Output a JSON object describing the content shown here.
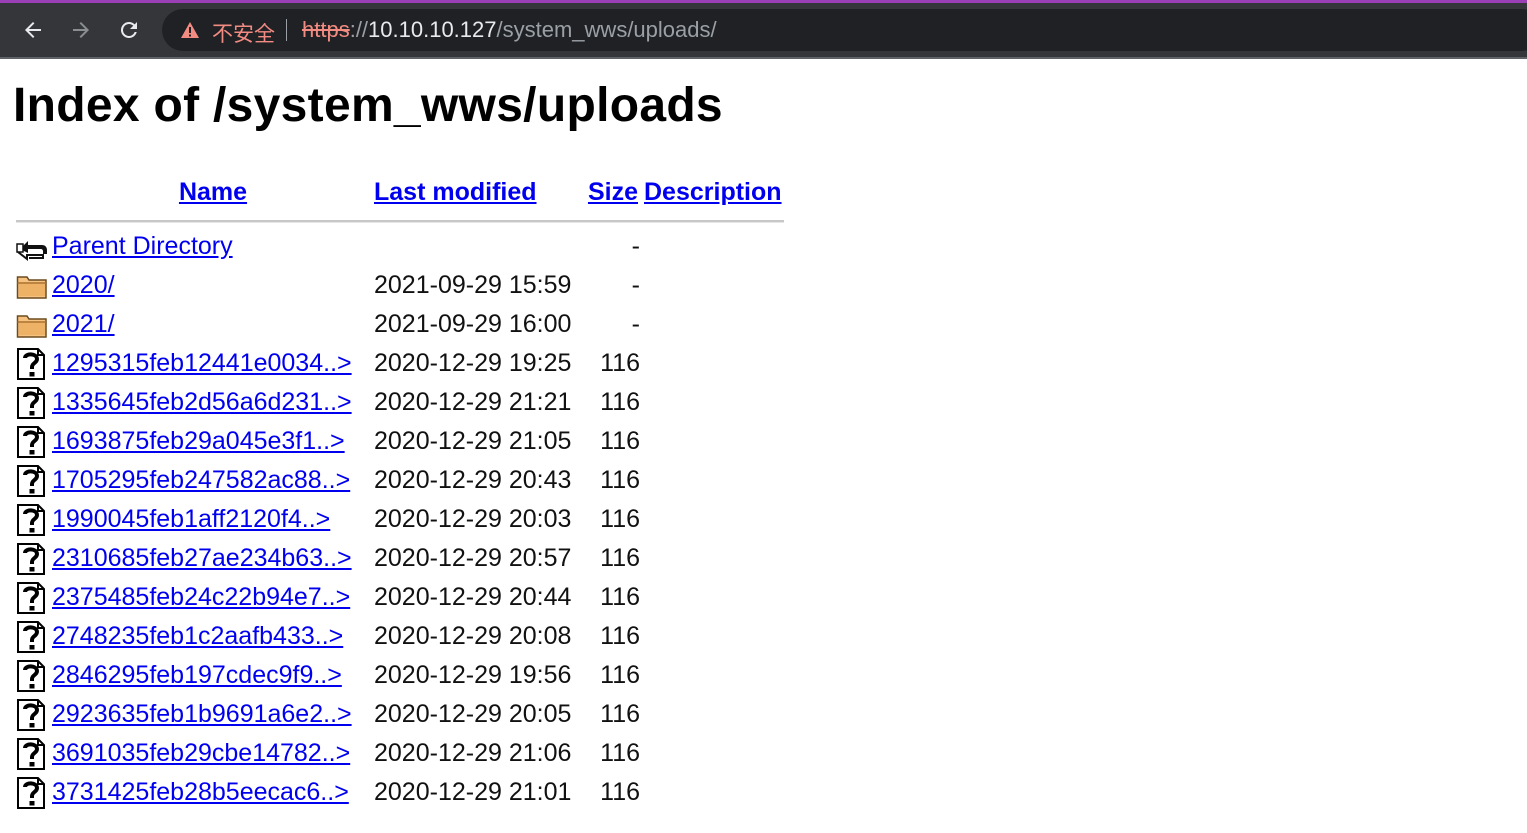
{
  "browser": {
    "insecure_label": "不安全",
    "url_scheme": "https",
    "url_sep": "://",
    "url_host": "10.10.10.127",
    "url_path": "/system_wws/uploads/"
  },
  "page": {
    "title": "Index of /system_wws/uploads"
  },
  "table": {
    "headers": {
      "name": "Name",
      "last_modified": "Last modified",
      "size": "Size",
      "description": "Description"
    },
    "rows": [
      {
        "icon": "back-icon",
        "name": "Parent Directory",
        "modified": "",
        "size": "-"
      },
      {
        "icon": "folder-icon",
        "name": "2020/",
        "modified": "2021-09-29 15:59",
        "size": "-"
      },
      {
        "icon": "folder-icon",
        "name": "2021/",
        "modified": "2021-09-29 16:00",
        "size": "-"
      },
      {
        "icon": "unknown-file-icon",
        "name": "1295315feb12441e0034..>",
        "modified": "2020-12-29 19:25",
        "size": "116"
      },
      {
        "icon": "unknown-file-icon",
        "name": "1335645feb2d56a6d231..>",
        "modified": "2020-12-29 21:21",
        "size": "116"
      },
      {
        "icon": "unknown-file-icon",
        "name": "1693875feb29a045e3f1..>",
        "modified": "2020-12-29 21:05",
        "size": "116"
      },
      {
        "icon": "unknown-file-icon",
        "name": "1705295feb247582ac88..>",
        "modified": "2020-12-29 20:43",
        "size": "116"
      },
      {
        "icon": "unknown-file-icon",
        "name": "1990045feb1aff2120f4..>",
        "modified": "2020-12-29 20:03",
        "size": "116"
      },
      {
        "icon": "unknown-file-icon",
        "name": "2310685feb27ae234b63..>",
        "modified": "2020-12-29 20:57",
        "size": "116"
      },
      {
        "icon": "unknown-file-icon",
        "name": "2375485feb24c22b94e7..>",
        "modified": "2020-12-29 20:44",
        "size": "116"
      },
      {
        "icon": "unknown-file-icon",
        "name": "2748235feb1c2aafb433..>",
        "modified": "2020-12-29 20:08",
        "size": "116"
      },
      {
        "icon": "unknown-file-icon",
        "name": "2846295feb197cdec9f9..>",
        "modified": "2020-12-29 19:56",
        "size": "116"
      },
      {
        "icon": "unknown-file-icon",
        "name": "2923635feb1b9691a6e2..>",
        "modified": "2020-12-29 20:05",
        "size": "116"
      },
      {
        "icon": "unknown-file-icon",
        "name": "3691035feb29cbe14782..>",
        "modified": "2020-12-29 21:06",
        "size": "116"
      },
      {
        "icon": "unknown-file-icon",
        "name": "3731425feb28b5eecac6..>",
        "modified": "2020-12-29 21:01",
        "size": "116"
      }
    ]
  }
}
